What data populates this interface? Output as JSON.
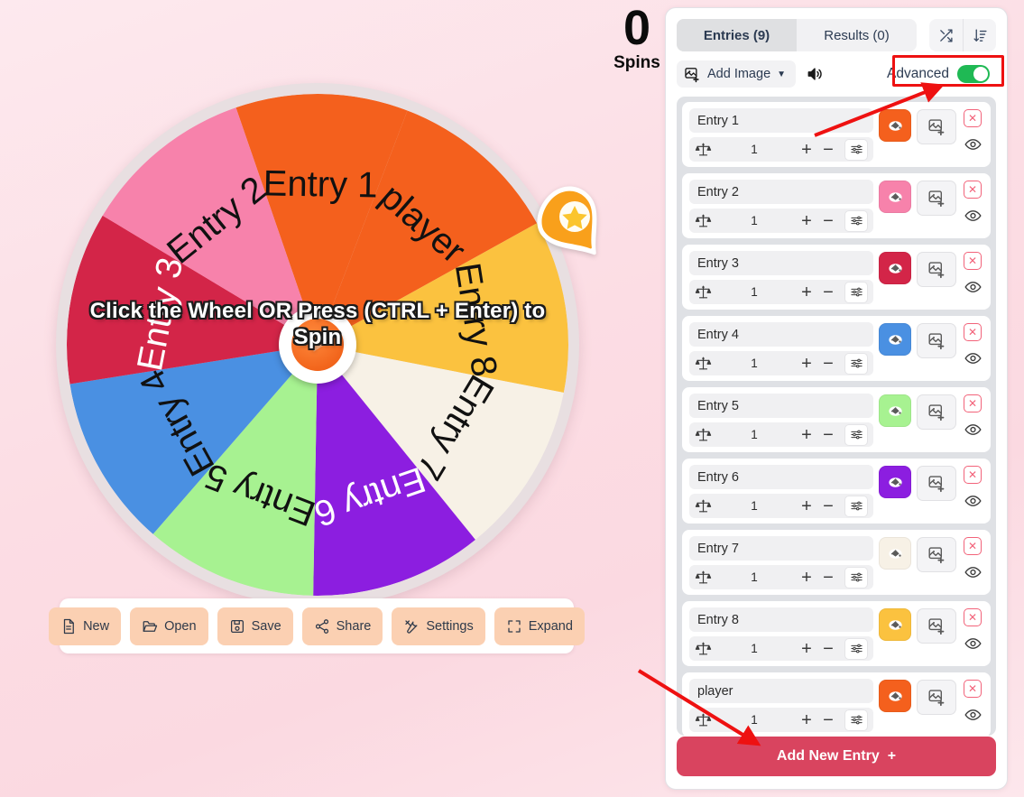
{
  "spins": {
    "count": "0",
    "label": "Spins"
  },
  "wheel": {
    "hint_text": "Click the Wheel OR Press (CTRL + Enter) to Spin",
    "pointer_icon": "star-pin-pointer-icon",
    "segments": [
      {
        "label": "Entry 1",
        "color": "#f4601d",
        "text_color": "#111111"
      },
      {
        "label": "player",
        "color": "#f4601d",
        "text_color": "#111111"
      },
      {
        "label": "Entry 8",
        "color": "#fbc23f",
        "text_color": "#111111"
      },
      {
        "label": "Entry 7",
        "color": "#f7f1e6",
        "text_color": "#111111"
      },
      {
        "label": "Entry 6",
        "color": "#8c1ee0",
        "text_color": "#ffffff"
      },
      {
        "label": "Entry 5",
        "color": "#a7f291",
        "text_color": "#111111"
      },
      {
        "label": "Entry 4",
        "color": "#4a90e2",
        "text_color": "#111111"
      },
      {
        "label": "Entry 3",
        "color": "#d32548",
        "text_color": "#ffffff"
      },
      {
        "label": "Entry 2",
        "color": "#f782ab",
        "text_color": "#111111"
      }
    ]
  },
  "toolbar": {
    "buttons": [
      {
        "label": "New",
        "icon": "file-icon"
      },
      {
        "label": "Open",
        "icon": "folder-open-icon"
      },
      {
        "label": "Save",
        "icon": "floppy-disk-icon"
      },
      {
        "label": "Share",
        "icon": "share-nodes-icon"
      },
      {
        "label": "Settings",
        "icon": "tools-icon"
      },
      {
        "label": "Expand",
        "icon": "expand-arrows-icon"
      }
    ]
  },
  "panel": {
    "tabs": [
      {
        "label": "Entries (9)",
        "active": true
      },
      {
        "label": "Results (0)",
        "active": false
      }
    ],
    "tab_actions": [
      {
        "name": "shuffle-icon",
        "title": "Shuffle"
      },
      {
        "name": "sort-descending-icon",
        "title": "Sort"
      }
    ],
    "add_image_label": "Add Image",
    "add_image_caret": "▼",
    "sound_icon": "speaker-icon",
    "advanced_label": "Advanced",
    "advanced_on": true,
    "advanced_accent": "#1fb954",
    "add_new_entry_label": "Add New Entry",
    "add_new_entry_plus": "+",
    "add_new_entry_color": "#d9445f"
  },
  "entries": [
    {
      "name": "Entry 1",
      "weight": "1",
      "color": "#f4601d",
      "icon_color": "#ffffff"
    },
    {
      "name": "Entry 2",
      "weight": "1",
      "color": "#f782ab",
      "icon_color": "#ffffff"
    },
    {
      "name": "Entry 3",
      "weight": "1",
      "color": "#d32548",
      "icon_color": "#ffffff"
    },
    {
      "name": "Entry 4",
      "weight": "1",
      "color": "#4a90e2",
      "icon_color": "#ffffff"
    },
    {
      "name": "Entry 5",
      "weight": "1",
      "color": "#a7f291",
      "icon_color": "#ffffff"
    },
    {
      "name": "Entry 6",
      "weight": "1",
      "color": "#8c1ee0",
      "icon_color": "#ffffff"
    },
    {
      "name": "Entry 7",
      "weight": "1",
      "color": "#f7f1e6",
      "icon_color": "#9a9a9a"
    },
    {
      "name": "Entry 8",
      "weight": "1",
      "color": "#fbc23f",
      "icon_color": "#ffffff"
    },
    {
      "name": "player",
      "weight": "1",
      "color": "#f4601d",
      "icon_color": "#ffffff"
    }
  ],
  "entry_row_icons": {
    "weight_icon": "balance-scale-icon",
    "plus": "+",
    "minus": "−",
    "sliders_icon": "sliders-icon",
    "color_icon": "paint-bucket-icon",
    "image_icon": "add-image-icon",
    "delete_icon": "close-x-icon",
    "visibility_icon": "eye-icon"
  },
  "annotations": {
    "highlight_color": "#ee1111",
    "arrow_color": "#ee1111",
    "targets": [
      "advanced-toggle",
      "add-new-entry-button"
    ]
  }
}
